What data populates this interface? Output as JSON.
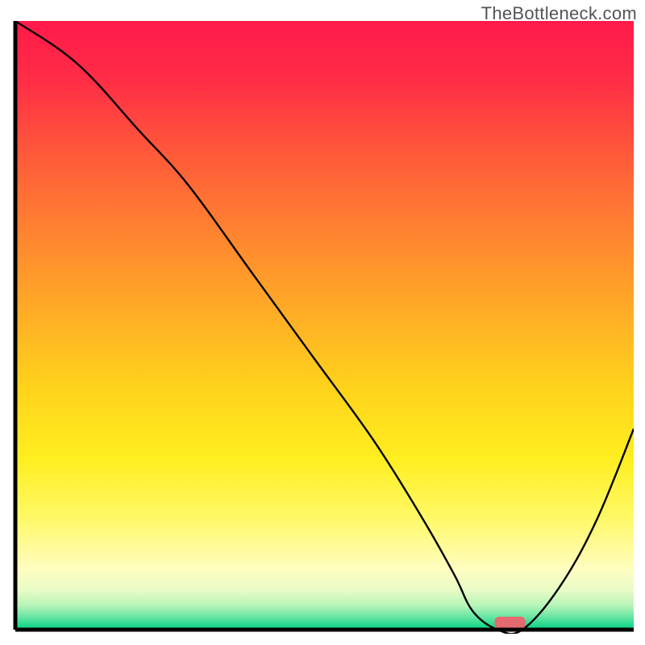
{
  "watermark": "TheBottleneck.com",
  "chart_data": {
    "type": "line",
    "title": "",
    "xlabel": "",
    "ylabel": "",
    "xlim": [
      0,
      100
    ],
    "ylim": [
      0,
      100
    ],
    "background": {
      "type": "vertical-gradient",
      "stops": [
        {
          "offset": 0.0,
          "color": "#ff1a4a"
        },
        {
          "offset": 0.1,
          "color": "#ff2e46"
        },
        {
          "offset": 0.22,
          "color": "#ff5a3a"
        },
        {
          "offset": 0.35,
          "color": "#ff8430"
        },
        {
          "offset": 0.48,
          "color": "#ffad26"
        },
        {
          "offset": 0.6,
          "color": "#ffd21c"
        },
        {
          "offset": 0.72,
          "color": "#ffee20"
        },
        {
          "offset": 0.82,
          "color": "#fff96a"
        },
        {
          "offset": 0.9,
          "color": "#fffdc0"
        },
        {
          "offset": 0.935,
          "color": "#e9fbc6"
        },
        {
          "offset": 0.96,
          "color": "#b7f4b8"
        },
        {
          "offset": 0.978,
          "color": "#6de6a4"
        },
        {
          "offset": 0.993,
          "color": "#20d98e"
        },
        {
          "offset": 1.0,
          "color": "#12cf86"
        }
      ]
    },
    "series": [
      {
        "name": "bottleneck-curve",
        "color": "#000000",
        "x": [
          0,
          10,
          20,
          28,
          38,
          48,
          58,
          66,
          71,
          74,
          78,
          82,
          88,
          94,
          100
        ],
        "values": [
          100,
          93,
          82,
          73,
          59,
          45,
          31,
          18,
          9,
          3,
          0,
          0,
          7,
          18,
          33
        ]
      }
    ],
    "marker": {
      "name": "optimal-point",
      "x": 80,
      "y": 0,
      "width": 5,
      "height": 2,
      "color": "#e46a6f"
    },
    "axes": {
      "color": "#000000",
      "thickness_px": 5
    }
  }
}
